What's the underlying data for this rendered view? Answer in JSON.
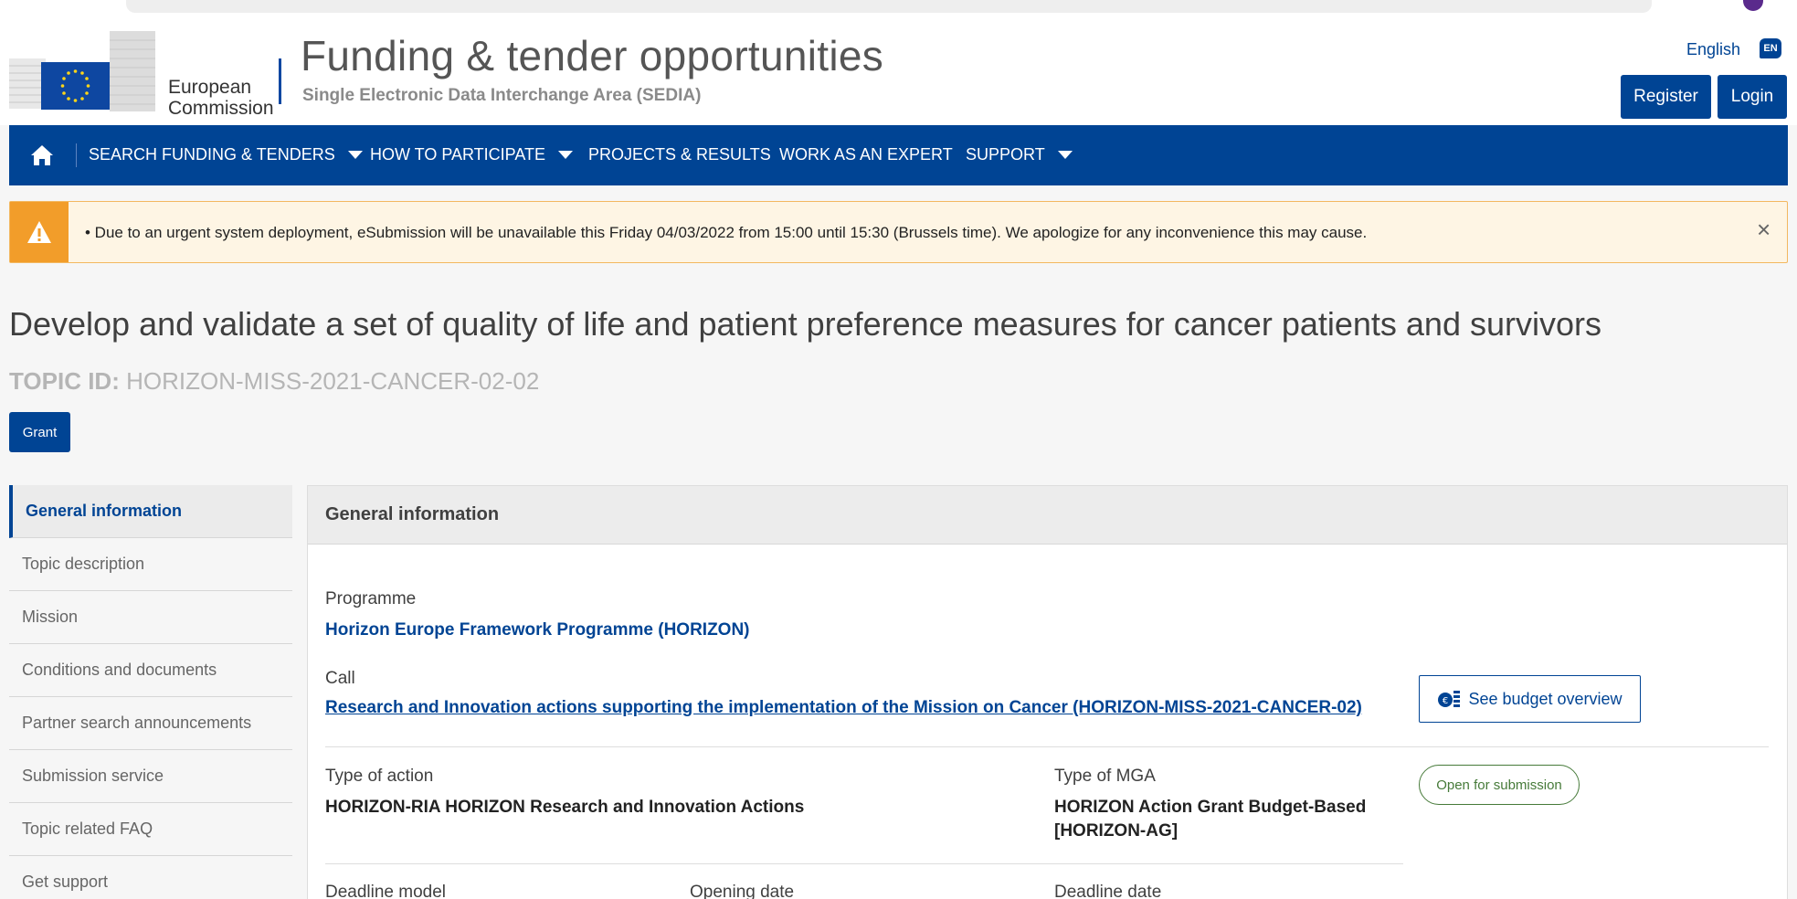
{
  "header": {
    "logo_line1": "European",
    "logo_line2": "Commission",
    "site_title": "Funding & tender opportunities",
    "site_subtitle": "Single Electronic Data Interchange Area (SEDIA)",
    "language": "English",
    "language_code": "EN",
    "register_label": "Register",
    "login_label": "Login"
  },
  "nav": {
    "items": [
      {
        "label": "SEARCH FUNDING & TENDERS",
        "dropdown": true
      },
      {
        "label": "HOW TO PARTICIPATE",
        "dropdown": true
      },
      {
        "label": "PROJECTS & RESULTS",
        "dropdown": false
      },
      {
        "label": "WORK AS AN EXPERT",
        "dropdown": false
      },
      {
        "label": "SUPPORT",
        "dropdown": true
      }
    ]
  },
  "alert": {
    "text": "• Due to an urgent system deployment, eSubmission will be unavailable this Friday  04/03/2022 from 15:00 until 15:30 (Brussels time). We apologize for any inconvenience this may cause."
  },
  "topic": {
    "title": "Develop and validate a set of quality of life and patient preference measures for cancer patients and survivors",
    "id_label": "TOPIC ID:",
    "id_value": "HORIZON-MISS-2021-CANCER-02-02",
    "badge": "Grant"
  },
  "sidenav": {
    "items": [
      {
        "label": "General information",
        "active": true
      },
      {
        "label": "Topic description",
        "active": false
      },
      {
        "label": "Mission",
        "active": false
      },
      {
        "label": "Conditions and documents",
        "active": false
      },
      {
        "label": "Partner search announcements",
        "active": false
      },
      {
        "label": "Submission service",
        "active": false
      },
      {
        "label": "Topic related FAQ",
        "active": false
      },
      {
        "label": "Get support",
        "active": false
      }
    ]
  },
  "panel": {
    "heading": "General information",
    "programme_label": "Programme",
    "programme_value": "Horizon Europe Framework Programme (HORIZON)",
    "call_label": "Call",
    "call_value": "Research and Innovation actions supporting the implementation of the Mission on Cancer (HORIZON-MISS-2021-CANCER-02)",
    "budget_button": "See budget overview",
    "type_action_label": "Type of action",
    "type_action_value": "HORIZON-RIA HORIZON Research and Innovation Actions",
    "type_mga_label": "Type of MGA",
    "type_mga_value_line1": "HORIZON Action Grant Budget-Based",
    "type_mga_value_line2": "[HORIZON-AG]",
    "status": "Open for submission",
    "deadline_model_label": "Deadline model",
    "opening_date_label": "Opening date",
    "deadline_date_label": "Deadline date"
  },
  "colors": {
    "brand_blue": "#004494",
    "alert_orange": "#f29d2a",
    "status_green": "#467a39"
  }
}
